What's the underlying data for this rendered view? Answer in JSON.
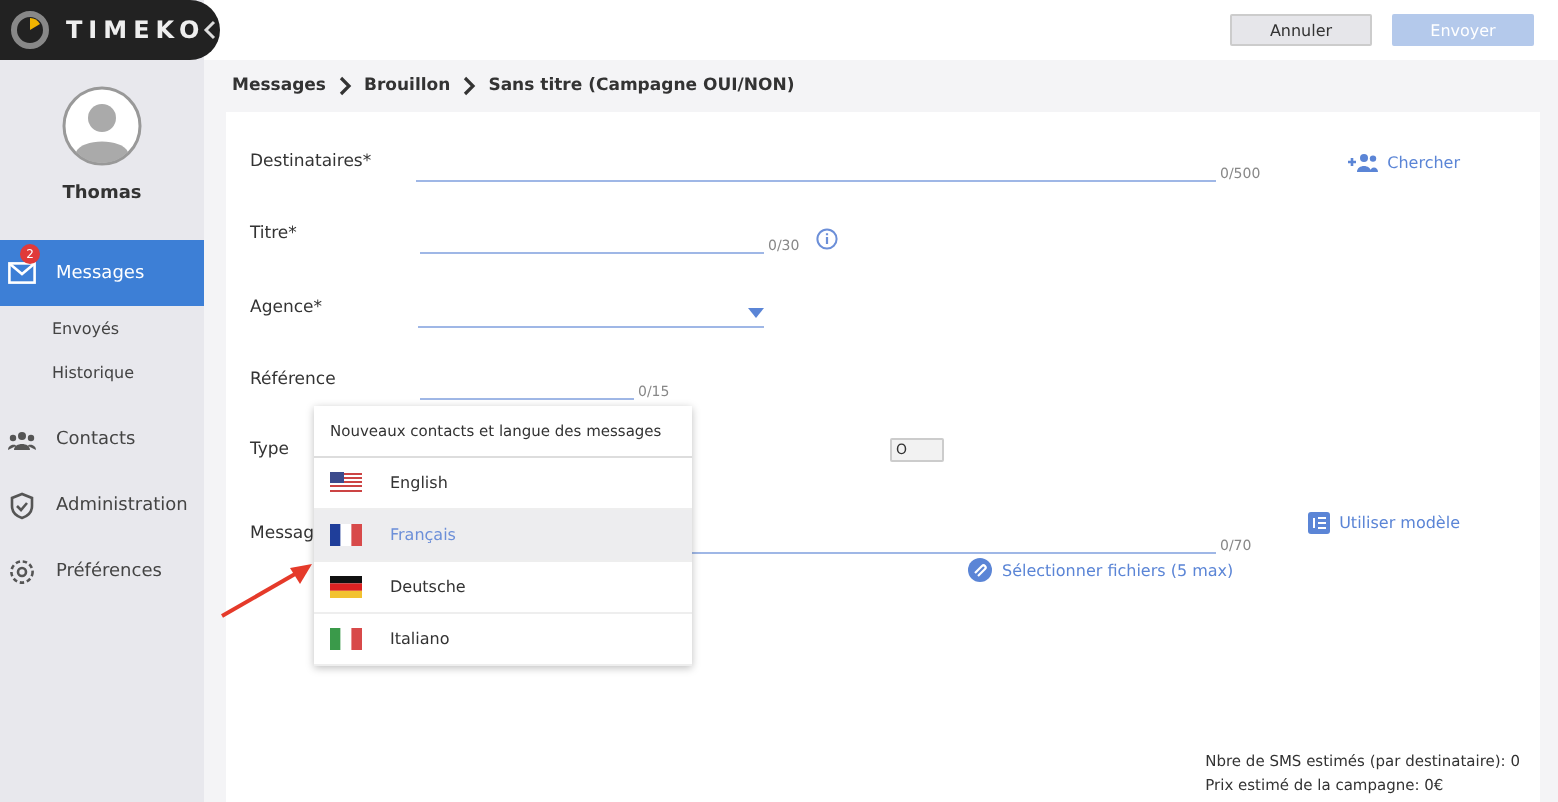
{
  "header": {
    "logo": "TIMEKO"
  },
  "topbar": {
    "buttons": [
      {
        "label": "Annuler",
        "disabled": false
      },
      {
        "label": "Envoyer",
        "disabled": true
      }
    ]
  },
  "sidebar": {
    "user": "Thomas",
    "items": [
      {
        "label": "Messages",
        "selected": true,
        "badge": "2",
        "children": [
          {
            "label": "Envoyés"
          },
          {
            "label": "Historique"
          }
        ]
      },
      {
        "label": "Contacts",
        "selected": false
      },
      {
        "label": "Administration",
        "selected": false
      },
      {
        "label": "Préférences",
        "selected": false
      }
    ]
  },
  "breadcrumb": [
    "Messages",
    "Brouillon",
    "Sans titre (Campagne OUI/NON)"
  ],
  "form": {
    "fields": [
      {
        "kind": "text",
        "label": "Destinataires*",
        "counter": "0/500",
        "action": "Chercher"
      },
      {
        "kind": "text",
        "label": "Titre*",
        "counter": "0/30",
        "info": true
      },
      {
        "kind": "select",
        "label": "Agence*"
      },
      {
        "kind": "text",
        "label": "Référence",
        "counter": "0/15"
      },
      {
        "kind": "toggle",
        "label": "Type",
        "value": "O"
      },
      {
        "kind": "text",
        "label": "Messag",
        "counter": "0/70",
        "action": "Utiliser modèle",
        "attach": "Sélectionner fichiers (5 max)"
      }
    ]
  },
  "dropdown": {
    "title": "Nouveaux contacts et langue des messages",
    "options": [
      {
        "label": "English",
        "selected": false
      },
      {
        "label": "Français",
        "selected": true
      },
      {
        "label": "Deutsche",
        "selected": false
      },
      {
        "label": "Italiano",
        "selected": false
      }
    ]
  },
  "footer": {
    "lines": [
      "Nbre de SMS estimés (par destinataire): 0",
      "Prix estimé de la campagne: 0€"
    ]
  }
}
